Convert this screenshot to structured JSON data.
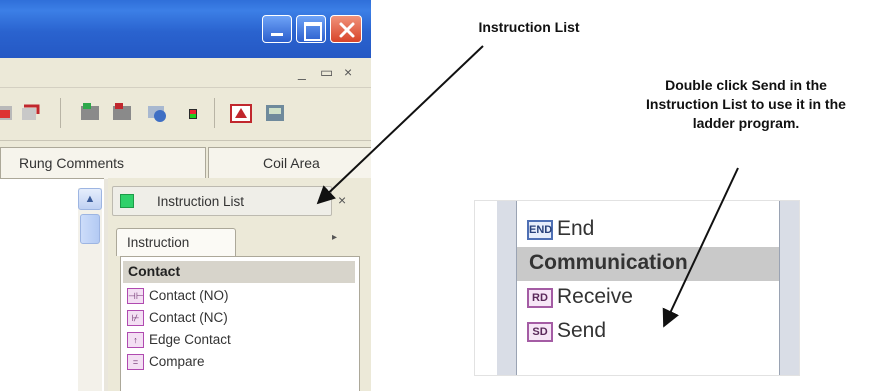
{
  "window": {
    "minimize": "_",
    "restore": "▭",
    "close": "×"
  },
  "toolbar": {
    "icons": [
      "record-icon",
      "transfer-icon",
      "program-icon",
      "network-icon",
      "stop-icon",
      "monitor-icon",
      "io-icon"
    ]
  },
  "tabs": {
    "rung_comments": "Rung Comments",
    "coil_area": "Coil Area"
  },
  "instruction_pane": {
    "header": "Instruction List",
    "close": "×",
    "tab": "Instruction",
    "tab_arrow": "▸",
    "group": "Contact",
    "items": [
      {
        "label": "Contact (NO)",
        "icon": "contact-no-icon"
      },
      {
        "label": "Contact (NC)",
        "icon": "contact-nc-icon"
      },
      {
        "label": "Edge Contact",
        "icon": "edge-contact-icon"
      },
      {
        "label": "Compare",
        "icon": "compare-icon"
      }
    ]
  },
  "zoom": {
    "end": {
      "label": "End",
      "icon_text": "END"
    },
    "group": "Communication",
    "receive": {
      "label": "Receive",
      "icon_text": "RD"
    },
    "send": {
      "label": "Send",
      "icon_text": "SD"
    }
  },
  "callouts": {
    "instruction_list": "Instruction List",
    "send_line1": "Double click Send in the",
    "send_line2": "Instruction List to use it in the",
    "send_line3": "ladder program."
  },
  "colors": {
    "titlebar": "#2f6fd9",
    "close_button": "#d8442a",
    "pane_indicator": "#2fd16a",
    "group_highlight": "#c9c9c9"
  }
}
